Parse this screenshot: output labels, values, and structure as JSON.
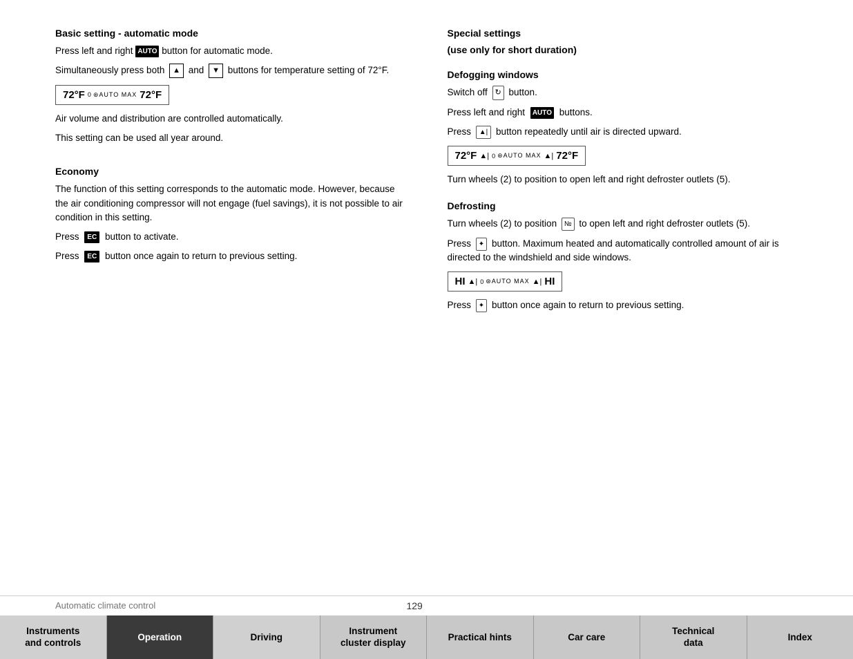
{
  "page": {
    "page_number": "129",
    "footer_label": "Automatic climate control"
  },
  "left_column": {
    "section1": {
      "title": "Basic setting - automatic mode",
      "para1": "Press left and right",
      "auto_badge": "AUTO",
      "para1_cont": "button for automatic mode.",
      "para2_pre": "Simultaneously press both",
      "para2_mid": "and",
      "para2_post": "buttons for temperature setting of 72°F.",
      "display": {
        "left_temp": "72°F",
        "right_temp": "72°F",
        "scale_label": "⊛AUTO MAX"
      },
      "para3": "Air volume and distribution are controlled automatically.",
      "para4": "This setting can be used all year around."
    },
    "section2": {
      "title": "Economy",
      "para1": "The function of this setting corresponds to the automatic mode. However, because the air conditioning compressor will not engage (fuel savings), it is not possible to air condition in this setting.",
      "ec_badge": "EC",
      "press1_pre": "Press",
      "press1_post": "button to activate.",
      "press2_pre": "Press",
      "press2_post": "button once again to return to previous setting."
    }
  },
  "right_column": {
    "section_header": {
      "title1": "Special settings",
      "title2": "(use only for short duration)"
    },
    "defogging": {
      "title": "Defogging windows",
      "para1_pre": "Switch off",
      "para1_post": "button.",
      "para2_pre": "Press left and right",
      "auto_badge": "AUTO",
      "para2_post": "buttons.",
      "para3_pre": "Press",
      "para3_post": "button repeatedly until air is directed upward.",
      "display": {
        "left_temp": "72°F",
        "right_temp": "72°F",
        "scale_label": "⊛AUTO MAX"
      },
      "para4": "Turn wheels (2) to position to open left and right defroster outlets (5)."
    },
    "defrosting": {
      "title": "Defrosting",
      "para1_pre": "Turn wheels (2) to position",
      "para1_post": "to open left and right defroster outlets (5).",
      "para2_pre": "Press",
      "para2_post": "button. Maximum heated and automatically controlled amount of air is directed to the windshield and side windows.",
      "display": {
        "left_temp": "HI",
        "right_temp": "HI",
        "scale_label": "⊛AUTO MAX"
      },
      "para3_pre": "Press",
      "para3_post": "button once again to return to previous setting."
    }
  },
  "nav_tabs": [
    {
      "id": "instruments-and-controls",
      "label": "Instruments\nand controls",
      "active": false
    },
    {
      "id": "operation",
      "label": "Operation",
      "active": true
    },
    {
      "id": "driving",
      "label": "Driving",
      "active": false
    },
    {
      "id": "instrument-cluster-display",
      "label": "Instrument\ncluster display",
      "active": false
    },
    {
      "id": "practical-hints",
      "label": "Practical hints",
      "active": false
    },
    {
      "id": "car-care",
      "label": "Car care",
      "active": false
    },
    {
      "id": "technical-data",
      "label": "Technical\ndata",
      "active": false
    },
    {
      "id": "index",
      "label": "Index",
      "active": false
    }
  ]
}
